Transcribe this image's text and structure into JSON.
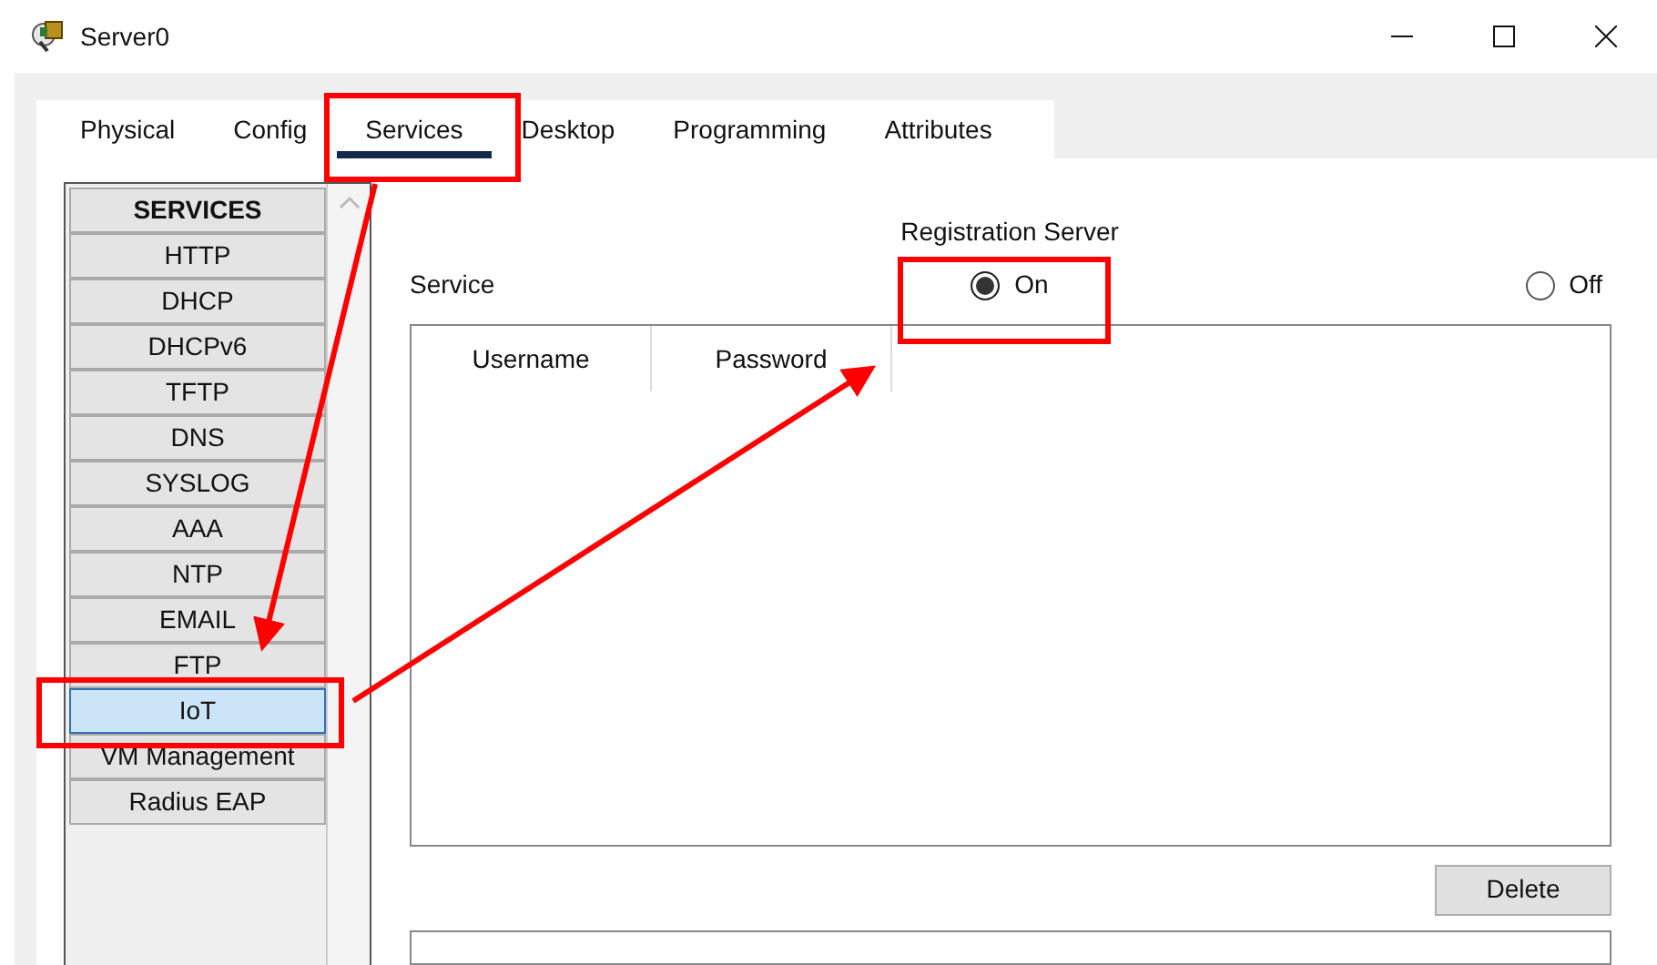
{
  "window": {
    "title": "Server0"
  },
  "tabs": [
    {
      "label": "Physical",
      "selected": false
    },
    {
      "label": "Config",
      "selected": false
    },
    {
      "label": "Services",
      "selected": true
    },
    {
      "label": "Desktop",
      "selected": false
    },
    {
      "label": "Programming",
      "selected": false
    },
    {
      "label": "Attributes",
      "selected": false
    }
  ],
  "services": {
    "header": "SERVICES",
    "items": [
      {
        "label": "HTTP",
        "selected": false
      },
      {
        "label": "DHCP",
        "selected": false
      },
      {
        "label": "DHCPv6",
        "selected": false
      },
      {
        "label": "TFTP",
        "selected": false
      },
      {
        "label": "DNS",
        "selected": false
      },
      {
        "label": "SYSLOG",
        "selected": false
      },
      {
        "label": "AAA",
        "selected": false
      },
      {
        "label": "NTP",
        "selected": false
      },
      {
        "label": "EMAIL",
        "selected": false
      },
      {
        "label": "FTP",
        "selected": false
      },
      {
        "label": "IoT",
        "selected": true
      },
      {
        "label": "VM Management",
        "selected": false
      },
      {
        "label": "Radius EAP",
        "selected": false
      }
    ]
  },
  "panel": {
    "title": "Registration Server",
    "service_label": "Service",
    "options": [
      {
        "label": "On",
        "selected": true
      },
      {
        "label": "Off",
        "selected": false
      }
    ],
    "table": {
      "columns": [
        "Username",
        "Password"
      ]
    },
    "delete_button": "Delete"
  }
}
